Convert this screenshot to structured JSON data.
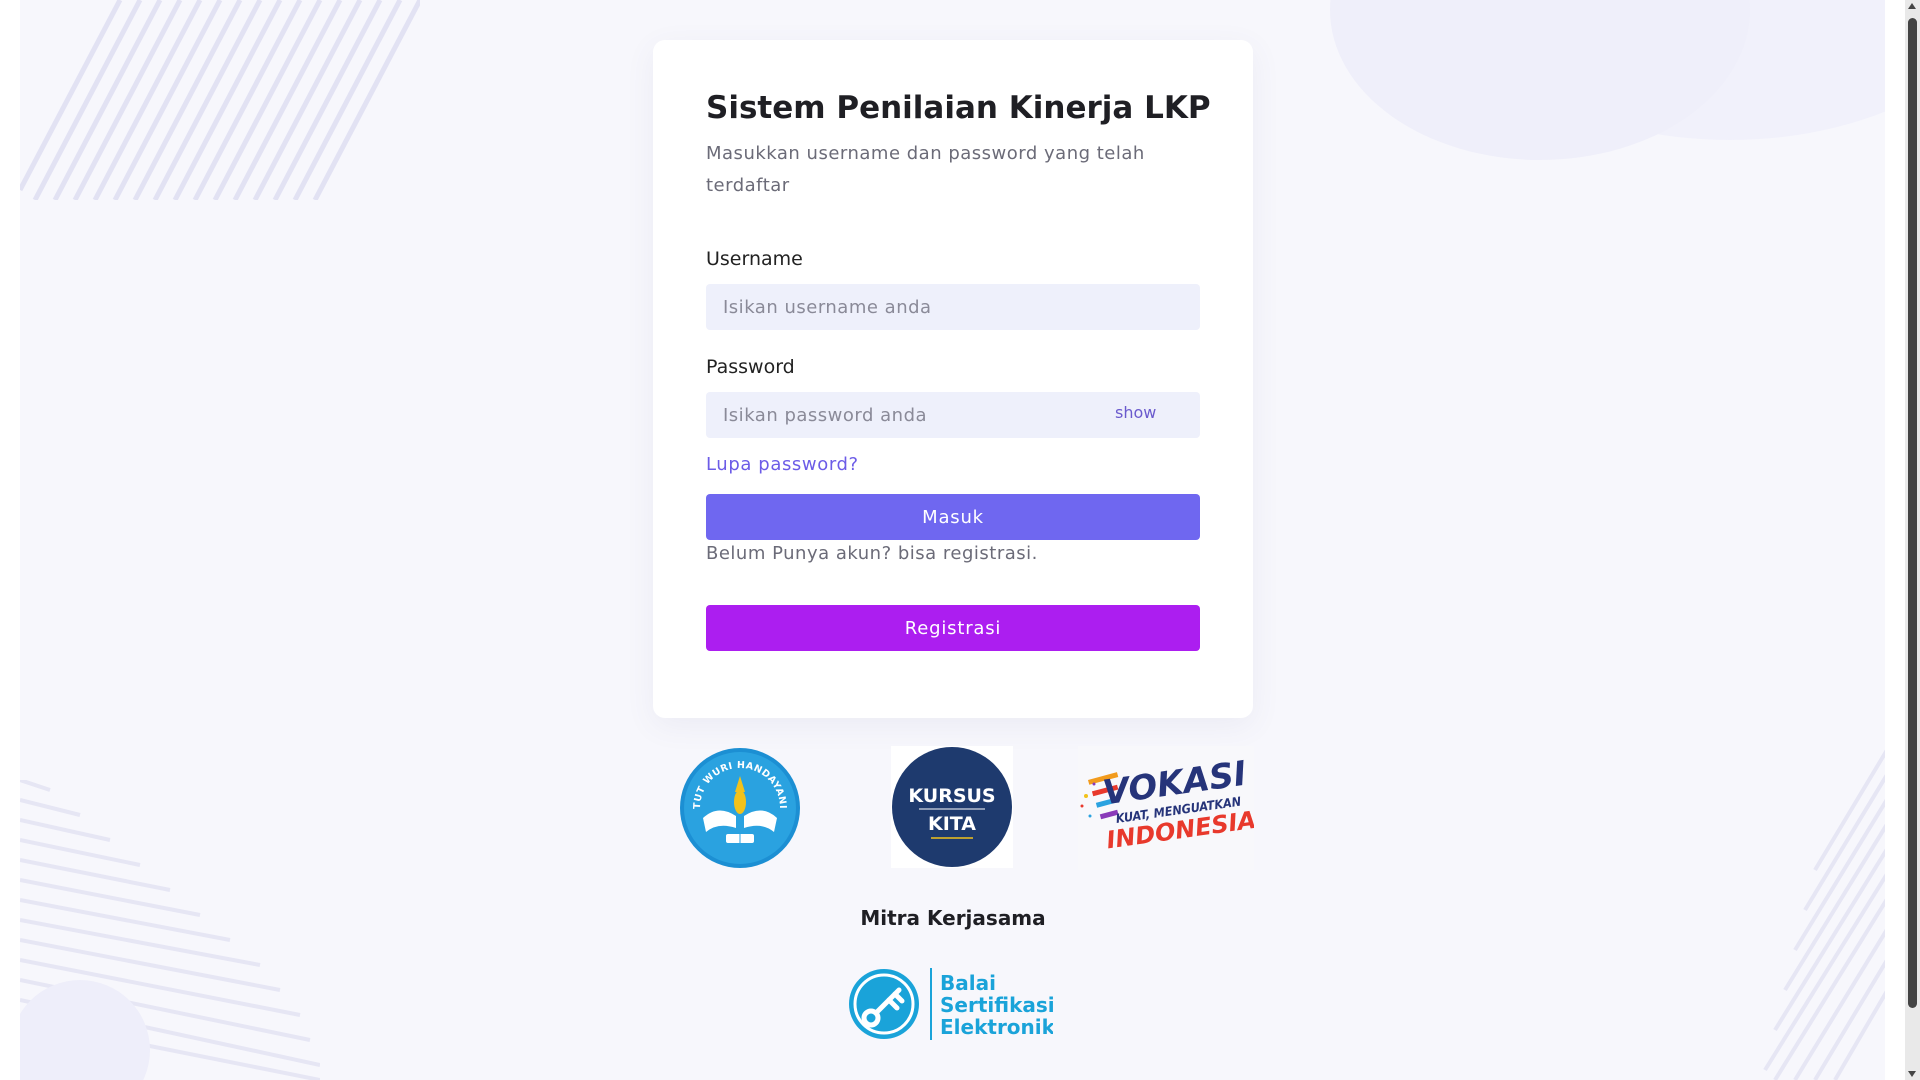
{
  "login": {
    "title": "Sistem Penilaian Kinerja LKP",
    "subtitle": "Masukkan username dan password yang telah terdaftar",
    "username_label": "Username",
    "username_placeholder": "Isikan username anda",
    "password_label": "Password",
    "password_placeholder": "Isikan password anda",
    "show_label": "show",
    "forgot_label": "Lupa password?",
    "submit_label": "Masuk",
    "no_account_text": "Belum Punya akun? bisa registrasi.",
    "register_label": "Registrasi"
  },
  "partners": {
    "logos": [
      {
        "name": "tut-wuri-handayani-logo",
        "text": "TUT WURI HANDAYANI"
      },
      {
        "name": "kursus-kita-logo",
        "line1": "KURSUS",
        "line2": "KITA"
      },
      {
        "name": "vokasi-logo",
        "line1": "VOKASI",
        "line2": "KUAT, MENGUATKAN",
        "line3": "INDONESIA"
      }
    ],
    "heading": "Mitra Kerjasama",
    "bse": {
      "line1": "Balai",
      "line2": "Sertifikasi",
      "line3": "Elektronik"
    }
  },
  "colors": {
    "primary": "#6f67f0",
    "register": "#ac1ef0",
    "link": "#6c5ce7",
    "input_bg": "#eef0fb",
    "bse_blue": "#1aa3d9",
    "kursus_navy": "#1e3a6e"
  }
}
